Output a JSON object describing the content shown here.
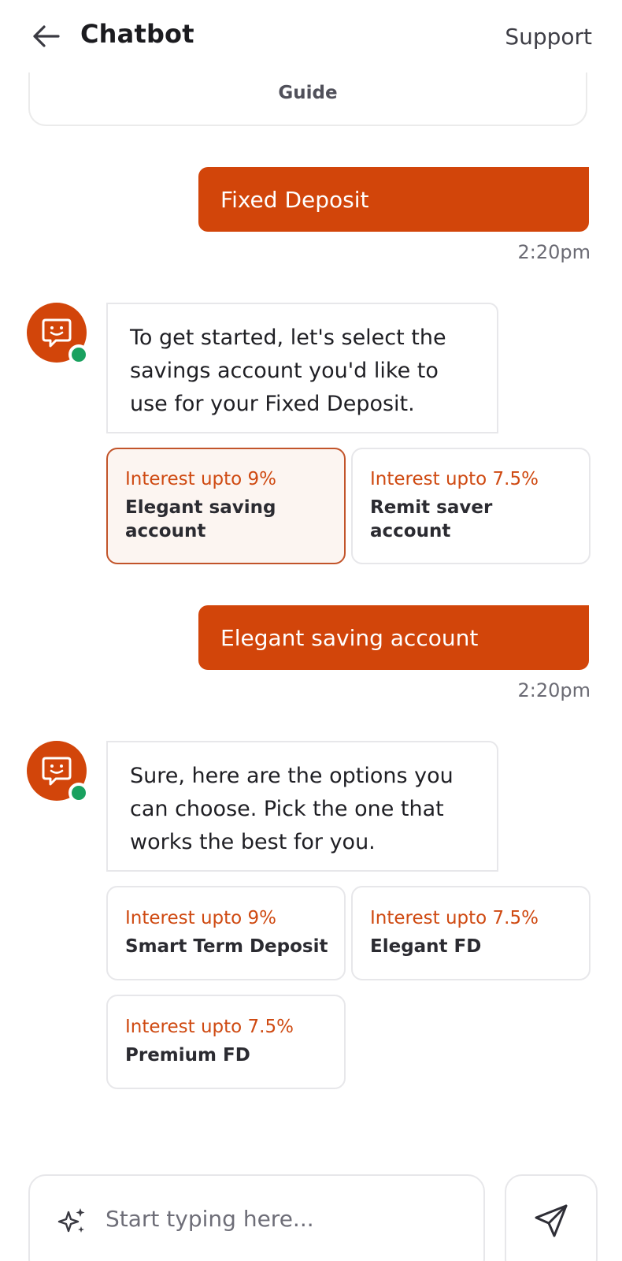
{
  "header": {
    "title": "Chatbot",
    "support_label": "Support"
  },
  "guide": {
    "label": "Guide"
  },
  "messages": [
    {
      "type": "user",
      "text": "Fixed Deposit",
      "time": "2:20pm"
    },
    {
      "type": "bot",
      "text": "To get started, let's select the savings account you'd like to use for your Fixed Deposit."
    },
    {
      "type": "user",
      "text": "Elegant saving account",
      "time": "2:20pm"
    },
    {
      "type": "bot",
      "text": "Sure, here are the options you can choose. Pick the one that works the best for you."
    }
  ],
  "account_options": [
    {
      "rate": "Interest upto 9%",
      "name": "Elegant saving account",
      "selected": true
    },
    {
      "rate": "Interest upto 7.5%",
      "name": "Remit saver account",
      "selected": false
    }
  ],
  "fd_options": [
    {
      "rate": "Interest upto 9%",
      "name": "Smart Term Deposit"
    },
    {
      "rate": "Interest upto 7.5%",
      "name": "Elegant FD"
    },
    {
      "rate": "Interest upto 7.5%",
      "name": "Premium FD"
    }
  ],
  "composer": {
    "placeholder": "Start typing here...",
    "sparkle_icon": "sparkle-icon",
    "send_icon": "send-icon"
  },
  "colors": {
    "accent": "#d2450a",
    "online": "#19a15f",
    "rate_text": "#cf4a12"
  }
}
